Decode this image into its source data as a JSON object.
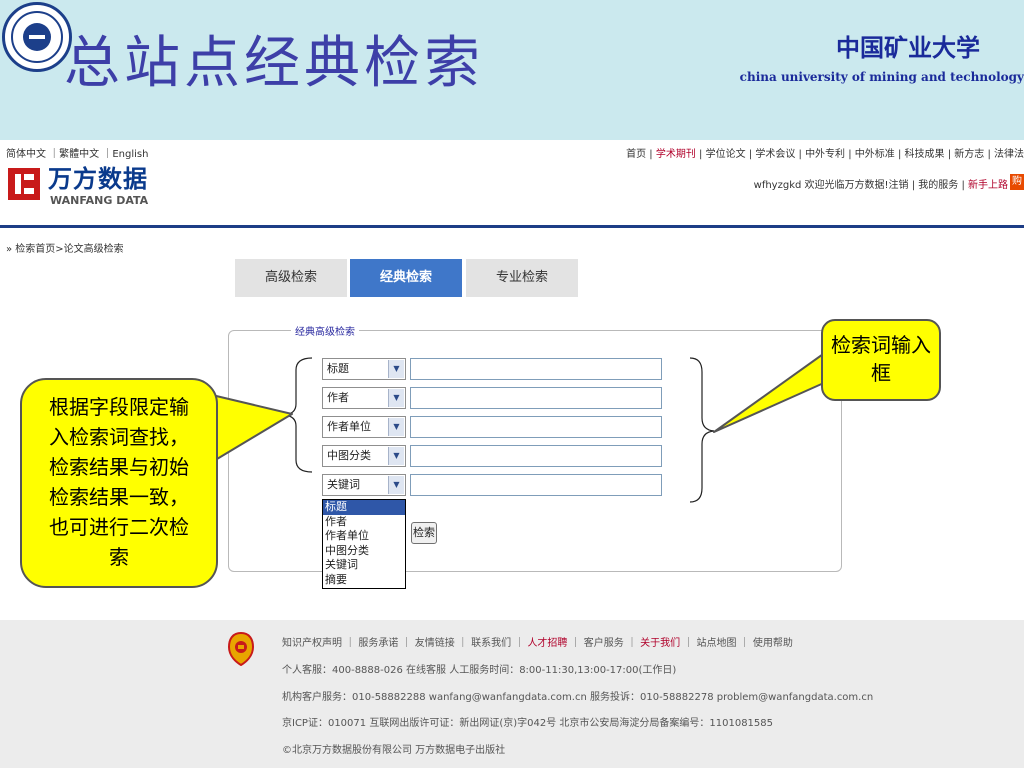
{
  "slide": {
    "title": "总站点经典检索",
    "university_cn": "中国矿业大学",
    "university_en": "china university of mining and technology"
  },
  "site": {
    "lang_links": "简体中文 ｜繁體中文 ｜English",
    "logo_cn": "万方数据",
    "logo_en": "WANFANG DATA",
    "top_nav": [
      "首页",
      "学术期刊",
      "学位论文",
      "学术会议",
      "中外专利",
      "中外标准",
      "科技成果",
      "新方志",
      "法律法"
    ],
    "user_bar": {
      "welcome": "wfhyzgkd 欢迎光临万方数据!",
      "logout": "注销",
      "my_service": "我的服务",
      "newbie": "新手上路",
      "cart": "购"
    },
    "breadcrumb": "» 检索首页>论文高级检索"
  },
  "search": {
    "tabs": [
      {
        "label": "高级检索"
      },
      {
        "label": "经典检索"
      },
      {
        "label": "专业检索"
      }
    ],
    "panel_title": "经典高级检索",
    "rows": [
      {
        "field": "标题",
        "value": ""
      },
      {
        "field": "作者",
        "value": ""
      },
      {
        "field": "作者单位",
        "value": ""
      },
      {
        "field": "中图分类",
        "value": ""
      },
      {
        "field": "关键词",
        "value": ""
      }
    ],
    "dropdown_options": [
      "标题",
      "作者",
      "作者单位",
      "中图分类",
      "关键词",
      "摘要"
    ],
    "button_label": "检索"
  },
  "annotations": {
    "left": "根据字段限定输入检索词查找，检索结果与初始检索结果一致，也可进行二次检索",
    "right": "检索词输入框"
  },
  "footer": {
    "links": [
      "知识产权声明",
      "服务承诺",
      "友情链接",
      "联系我们",
      "人才招聘",
      "客户服务",
      "关于我们",
      "站点地图",
      "使用帮助"
    ],
    "line2": "个人客服：400-8888-026 在线客服   人工服务时间：8:00-11:30,13:00-17:00(工作日)",
    "line3": "机构客户服务：010-58882288  wanfang@wanfangdata.com.cn    服务投诉：010-58882278 problem@wanfangdata.com.cn",
    "line4": "京ICP证：010071 互联网出版许可证：新出网证(京)字042号 北京市公安局海淀分局备案编号：1101081585",
    "line5": "©北京万方数据股份有限公司 万方数据电子出版社"
  },
  "colors": {
    "slide_bg": "#cbe9ee",
    "title": "#3d3fa8",
    "active_tab": "#3f77c9",
    "callout": "#ffff00",
    "rule": "#1d3d86"
  },
  "icons": [
    "university-seal-icon",
    "wanfang-logo-icon",
    "dropdown-arrow-icon",
    "footer-emblem-icon"
  ]
}
